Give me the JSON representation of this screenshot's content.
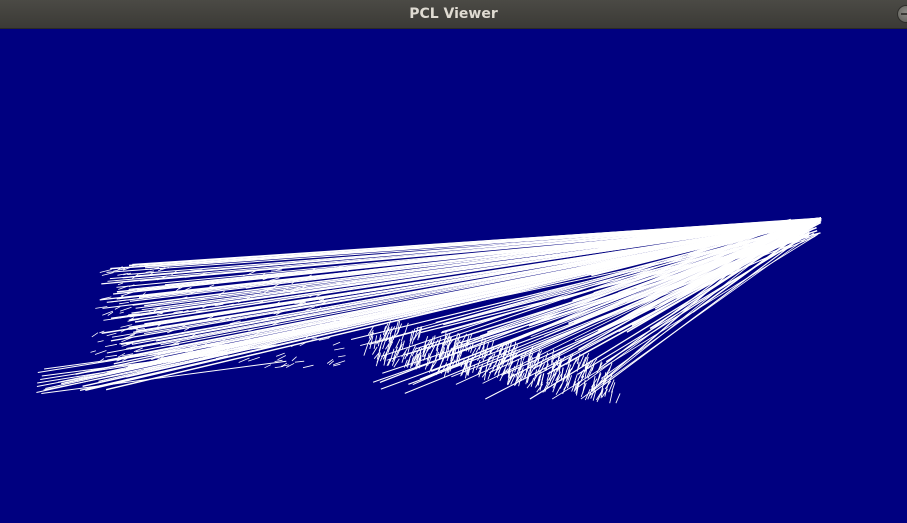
{
  "window": {
    "title": "PCL Viewer"
  },
  "icons": {
    "window_control": "minimize-icon"
  },
  "colors": {
    "background": "#000080",
    "lines": "#ffffff",
    "titlebar": "#403f3b"
  }
}
